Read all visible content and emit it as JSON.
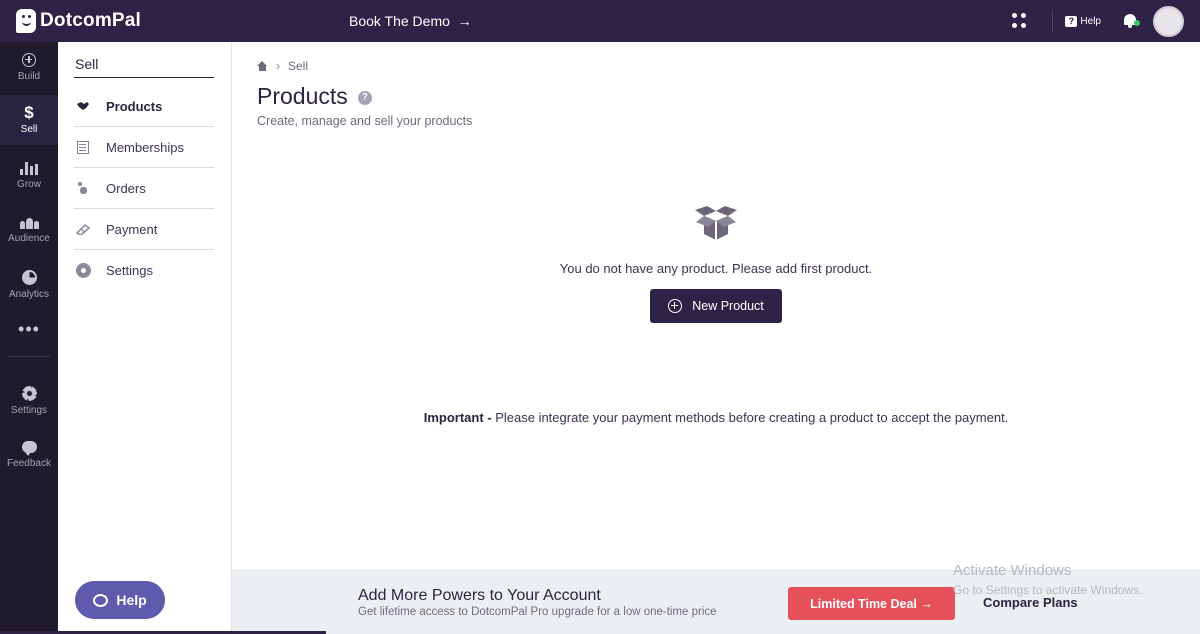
{
  "app": {
    "brand": "DotcomPal"
  },
  "topbar": {
    "book_demo": "Book The Demo",
    "book_demo_arrow": "→",
    "help": "Help",
    "help_glyph": "?",
    "notification_dot_color": "#3bc46a"
  },
  "rail": {
    "items": [
      {
        "label": "Build",
        "icon": "plus-circle-icon"
      },
      {
        "label": "Sell",
        "icon": "dollar-icon",
        "glyph": "$",
        "active": true
      },
      {
        "label": "Grow",
        "icon": "bar-chart-icon"
      },
      {
        "label": "Audience",
        "icon": "people-icon"
      },
      {
        "label": "Analytics",
        "icon": "pie-chart-icon"
      },
      {
        "label": "",
        "icon": "more-dots-icon",
        "glyph": "•••"
      },
      {
        "label": "Settings",
        "icon": "gear-icon"
      },
      {
        "label": "Feedback",
        "icon": "chat-bubble-icon"
      }
    ]
  },
  "subnav": {
    "title": "Sell",
    "items": [
      {
        "label": "Products",
        "icon": "handshake-icon",
        "active": true
      },
      {
        "label": "Memberships",
        "icon": "membership-icon"
      },
      {
        "label": "Orders",
        "icon": "orders-icon"
      },
      {
        "label": "Payment",
        "icon": "payment-icon"
      },
      {
        "label": "Settings",
        "icon": "gear-icon"
      }
    ],
    "help_button": "Help"
  },
  "main": {
    "breadcrumb": {
      "current": "Sell",
      "separator": "›"
    },
    "title": "Products",
    "info_glyph": "?",
    "subtitle": "Create, manage and sell your products",
    "empty_state": {
      "icon": "open-box-icon",
      "message": "You do not have any product. Please add first product.",
      "button": "New Product"
    },
    "important": {
      "label": "Important -",
      "text": " Please integrate your payment methods before creating a product to accept the payment."
    }
  },
  "banner": {
    "title": "Add More Powers to Your Account",
    "subtitle": "Get lifetime access to DotcomPal Pro upgrade for a low one-time price",
    "deal_button": "Limited Time Deal →",
    "compare_link": "Compare Plans",
    "deal_color": "#e5505b"
  },
  "os_watermark": {
    "line1": "Activate Windows",
    "line2": "Go to Settings to activate Windows."
  },
  "colors": {
    "topbar": "#2e2346",
    "rail": "#1f1a2e",
    "primary_button": "#2e2346",
    "help_pill": "#5f5aae"
  }
}
